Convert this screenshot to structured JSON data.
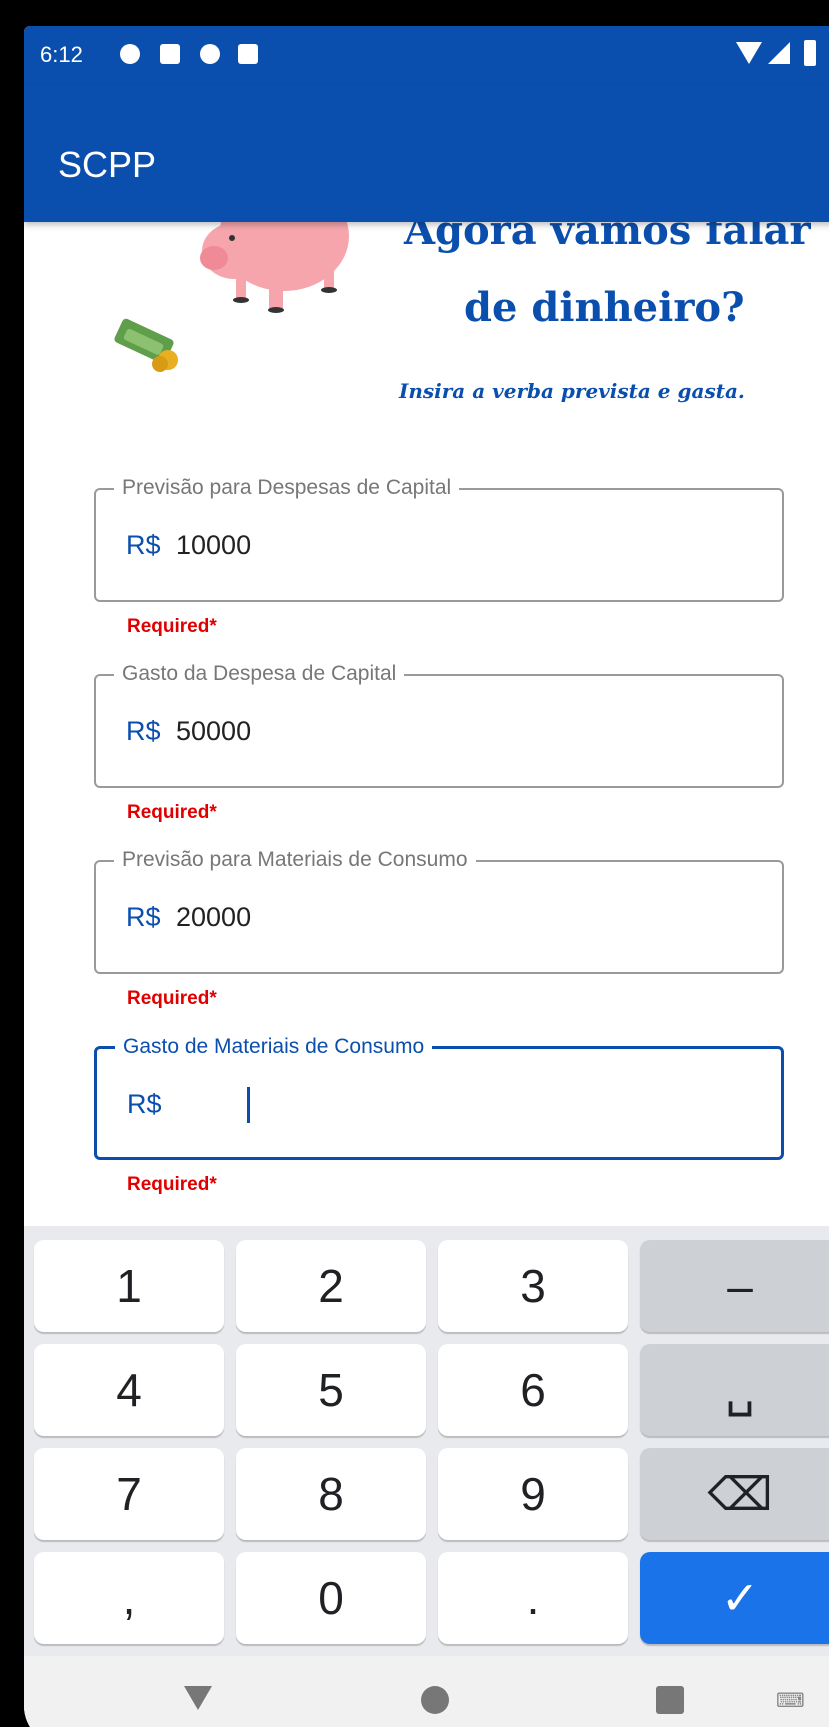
{
  "status_bar": {
    "time": "6:12"
  },
  "app_bar": {
    "title": "SCPP"
  },
  "header": {
    "headline_line1": "Agora vamos falar",
    "headline_line2": "de dinheiro?",
    "subtitle": "Insira a verba prevista e gasta."
  },
  "fields": [
    {
      "label": "Previsão para Despesas de Capital",
      "prefix": "R$",
      "value": "10000",
      "error": "Required*"
    },
    {
      "label": "Gasto da Despesa de Capital",
      "prefix": "R$",
      "value": "50000",
      "error": "Required*"
    },
    {
      "label": "Previsão para Materiais de Consumo",
      "prefix": "R$",
      "value": "20000",
      "error": "Required*"
    },
    {
      "label": "Gasto de Materiais de Consumo",
      "prefix": "R$",
      "value": "",
      "error": "Required*"
    }
  ],
  "keyboard": {
    "keys": [
      "1",
      "2",
      "3",
      "–",
      "4",
      "5",
      "6",
      "␣",
      "7",
      "8",
      "9",
      "⌫",
      ",",
      "0",
      ".",
      "✓"
    ]
  },
  "colors": {
    "primary": "#0b4fae",
    "error": "#e00000",
    "enter_key": "#1a73e8"
  }
}
